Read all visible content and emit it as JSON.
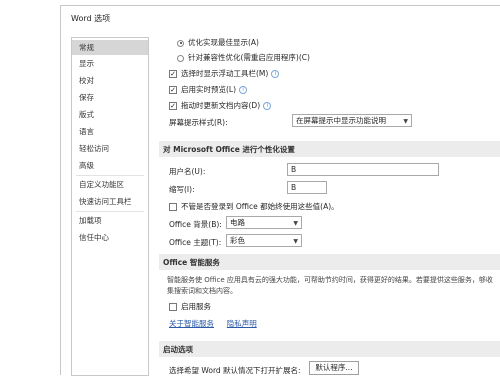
{
  "window": {
    "title": "Word 选项"
  },
  "sidebar": {
    "items": [
      {
        "label": "常规"
      },
      {
        "label": "显示"
      },
      {
        "label": "校对"
      },
      {
        "label": "保存"
      },
      {
        "label": "版式"
      },
      {
        "label": "语言"
      },
      {
        "label": "轻松访问"
      },
      {
        "label": "高级"
      },
      {
        "label": "自定义功能区"
      },
      {
        "label": "快速访问工具栏"
      },
      {
        "label": "加载项"
      },
      {
        "label": "信任中心"
      }
    ]
  },
  "ui_options": {
    "radio_optimize_display": "优化实现最佳显示(A)",
    "radio_optimize_compat": "针对兼容性优化(需重启应用程序)(C)",
    "check_mini_toolbar": "选择时显示浮动工具栏(M)",
    "check_live_preview": "启用实时预览(L)",
    "check_update_drag": "拖动时更新文档内容(D)",
    "screentip_label": "屏幕提示样式(R):",
    "screentip_value": "在屏幕提示中显示功能说明"
  },
  "personalize": {
    "header": "对 Microsoft Office 进行个性化设置",
    "username_label": "用户名(U):",
    "username_value": "B",
    "initials_label": "缩写(I):",
    "initials_value": "B",
    "always_use_label": "不管是否登录到 Office 都始终使用这些值(A)。",
    "background_label": "Office 背景(B):",
    "background_value": "电路",
    "theme_label": "Office 主题(T):",
    "theme_value": "彩色"
  },
  "intelligent": {
    "header": "Office 智能服务",
    "description": "智能服务使 Office 应用具有云的强大功能，可帮助节约时间，获得更好的结果。若要提供这些服务，够收集搜索词和文档内容。",
    "enable_label": "启用服务",
    "link_about": "关于智能服务",
    "link_privacy": "隐私声明"
  },
  "startup": {
    "header": "启动选项",
    "default_ext_label": "选择希望 Word 默认情况下打开扩展名:",
    "default_programs_button": "默认程序..."
  },
  "icons": {
    "check": "✓",
    "caret": "▼",
    "info": "i"
  },
  "colors": {
    "sidebar_active": "#d6d6d6",
    "section_bg": "#ececec",
    "link": "#2a5aa8"
  }
}
